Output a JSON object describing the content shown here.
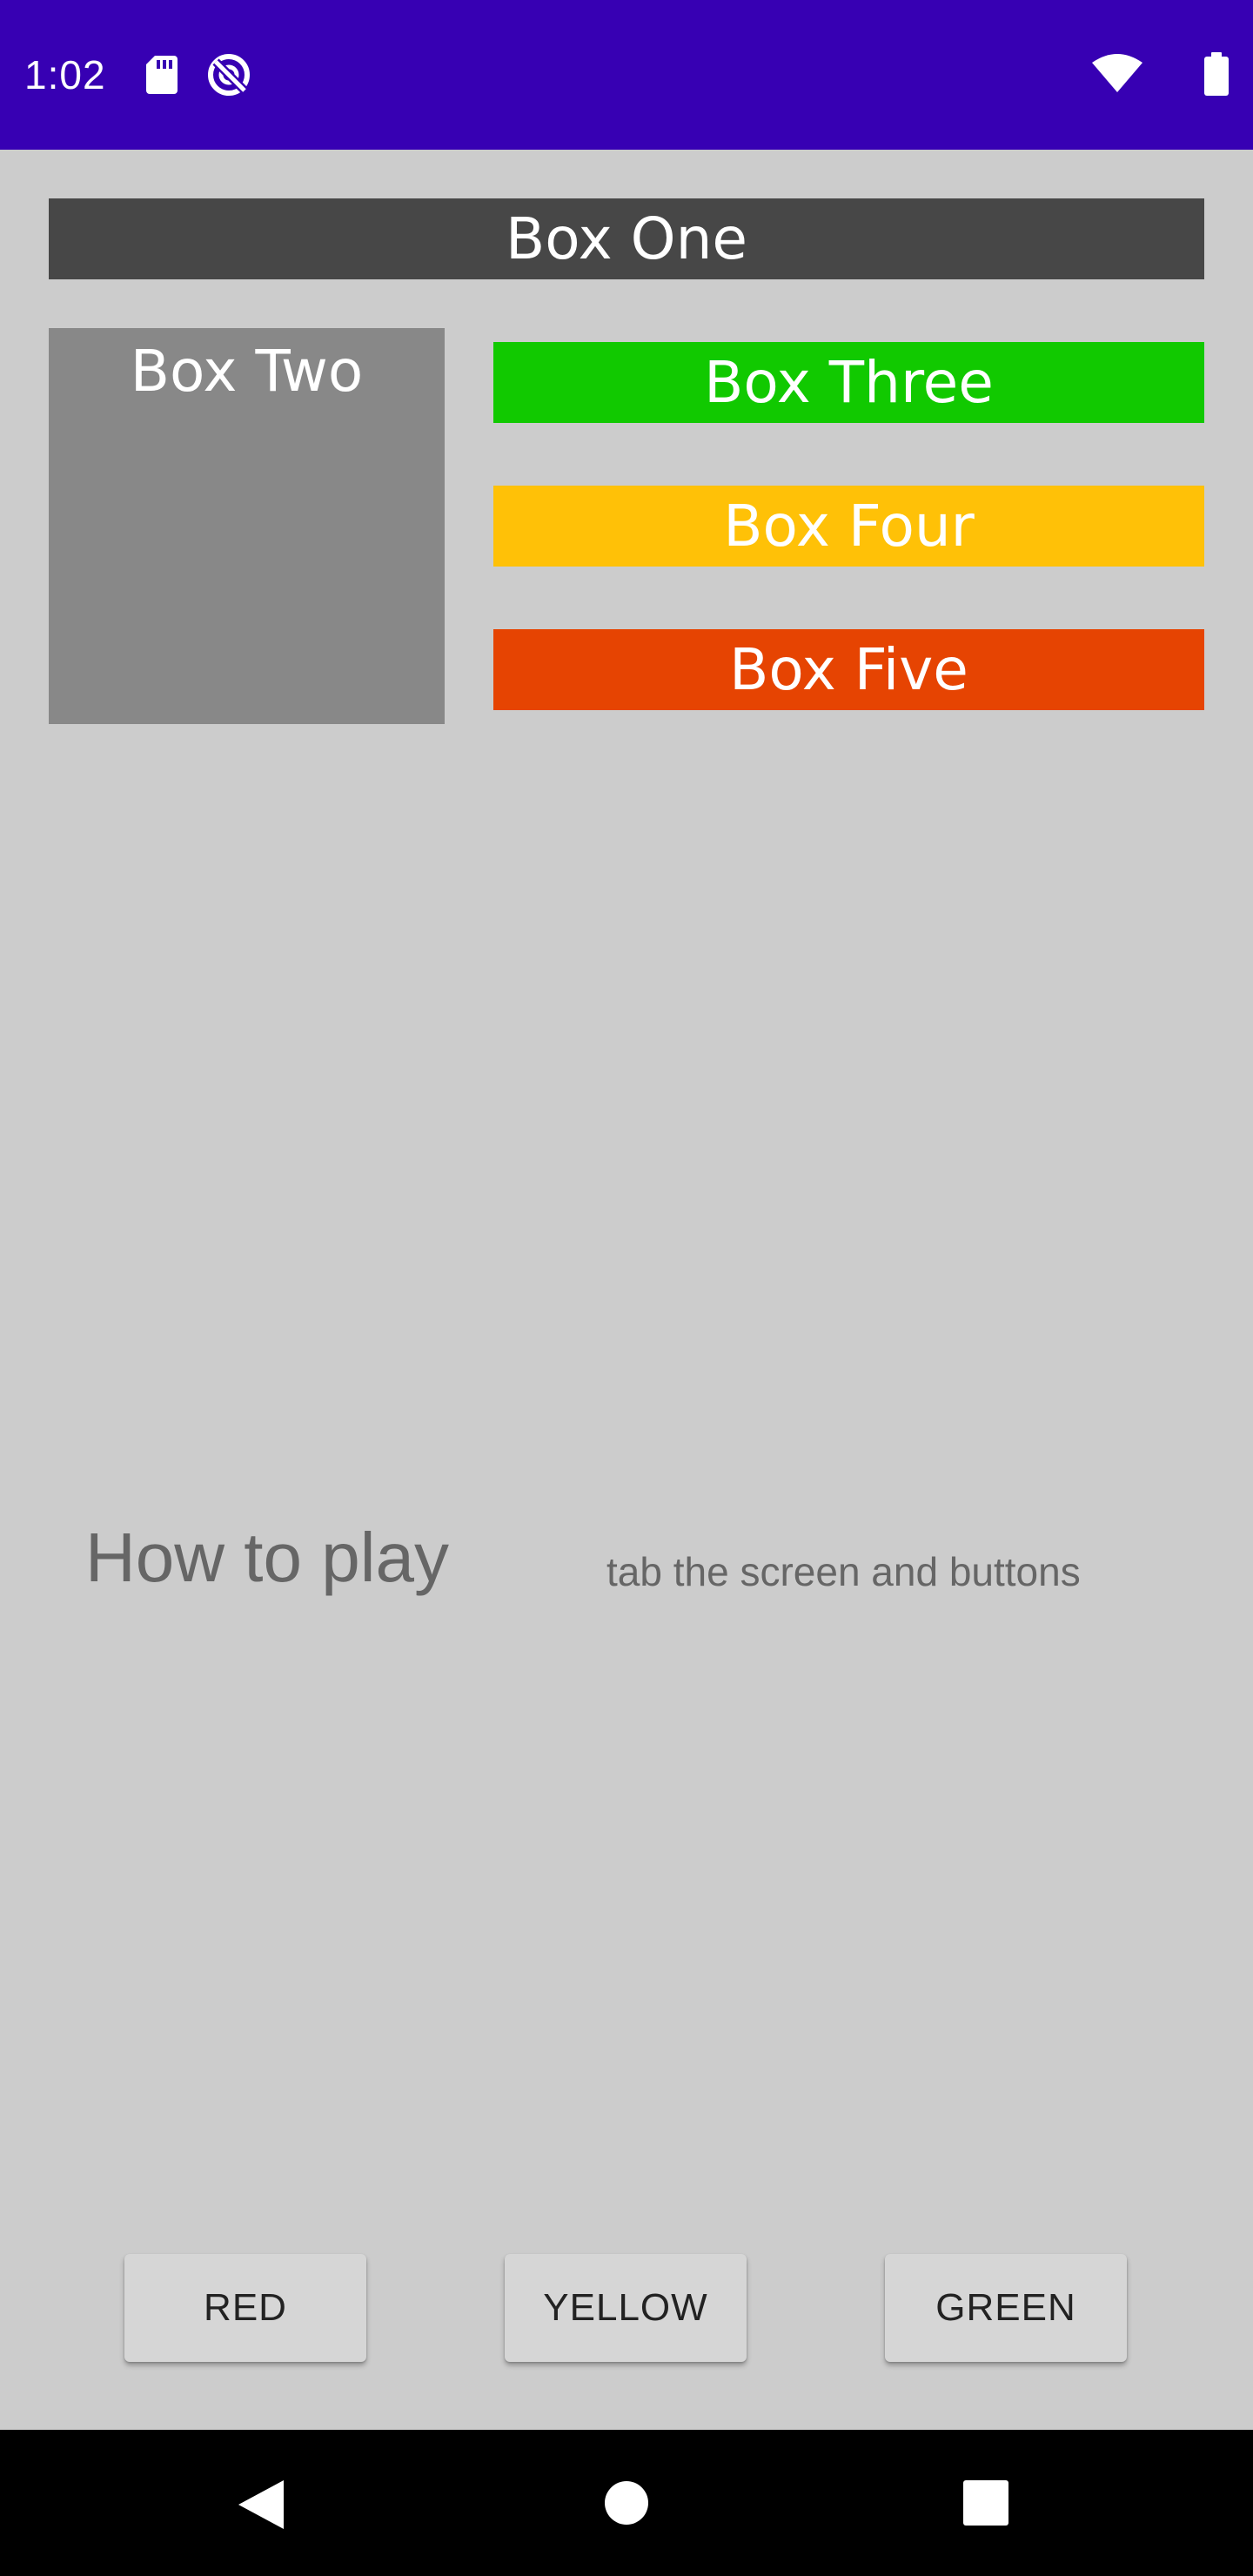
{
  "status_bar": {
    "time": "1:02",
    "icons": [
      "sd-card-icon",
      "sync-disabled-icon",
      "wifi-icon",
      "battery-icon"
    ],
    "background": "#3700b3"
  },
  "boxes": {
    "one": {
      "label": "Box One",
      "color": "#474747"
    },
    "two": {
      "label": "Box Two",
      "color": "#888888"
    },
    "three": {
      "label": "Box Three",
      "color": "#11c900"
    },
    "four": {
      "label": "Box Four",
      "color": "#ffc107"
    },
    "five": {
      "label": "Box Five",
      "color": "#e64402"
    }
  },
  "instructions": {
    "title": "How to play",
    "description": "tab the screen and buttons"
  },
  "buttons": {
    "red": "RED",
    "yellow": "YELLOW",
    "green": "GREEN"
  },
  "nav_bar": {
    "icons": [
      "back-icon",
      "home-icon",
      "recents-icon"
    ]
  },
  "colors": {
    "background": "#cccccc",
    "text_muted": "#666666"
  }
}
